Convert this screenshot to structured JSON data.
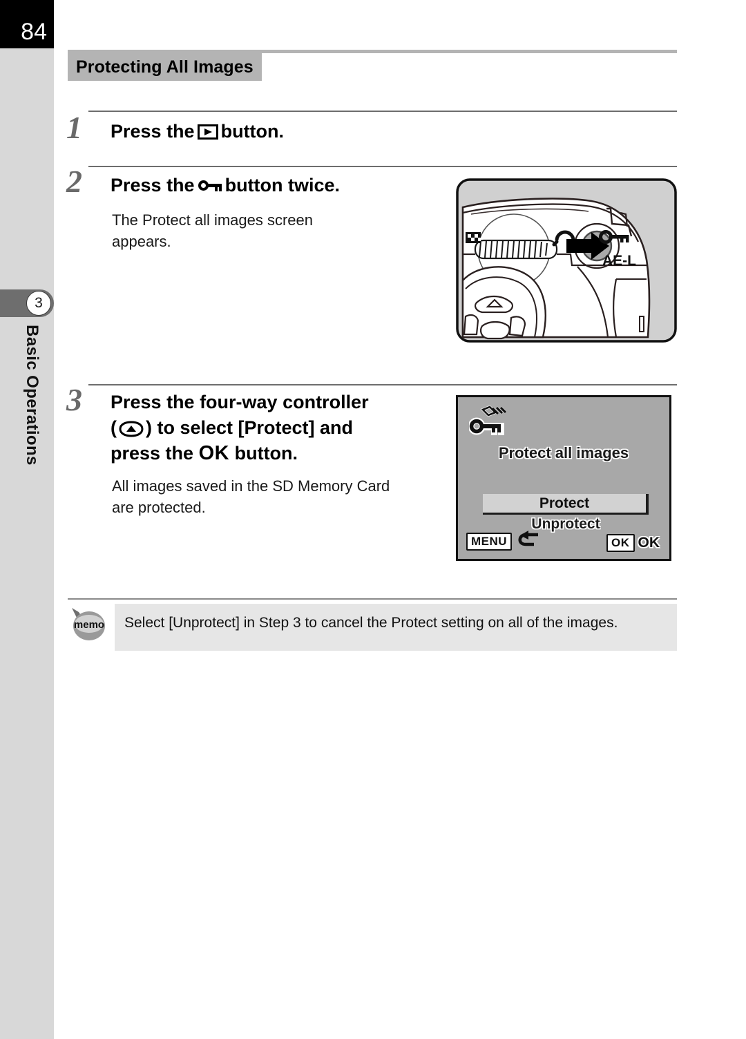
{
  "page": {
    "number": "84",
    "chapter_number": "3",
    "chapter_label": "Basic Operations"
  },
  "section": {
    "title": "Protecting All Images"
  },
  "steps": [
    {
      "number": "1",
      "heading_before": "Press the",
      "icon": "playback-button-icon",
      "heading_after": "button.",
      "body": ""
    },
    {
      "number": "2",
      "heading_before": "Press the",
      "icon": "protect-key-icon",
      "heading_after": "button twice.",
      "body": "The Protect all images screen appears."
    },
    {
      "number": "3",
      "heading_line1": "Press the four-way controller",
      "icon": "four-way-controller-up-icon",
      "heading_line2_before": "(",
      "heading_line2_after": ") to select [Protect] and",
      "heading_line3_before": "press the",
      "heading_ok": "OK",
      "heading_line3_after": "button.",
      "body": "All images saved in the SD Memory Card are protected."
    }
  ],
  "camera_figure": {
    "ae_l_label": "AE-L",
    "icons": [
      "checkerboard-index-icon",
      "magnify-icon",
      "protect-key-icon"
    ]
  },
  "lcd_figure": {
    "icon": "protect-all-images-icon",
    "title": "Protect all images",
    "options": [
      "Protect",
      "Unprotect"
    ],
    "selected_option": "Protect",
    "footer_left_key": "MENU",
    "footer_left_icon": "back-arrow-icon",
    "footer_right_key": "OK",
    "footer_right_label": "OK"
  },
  "memo": {
    "icon_label": "memo",
    "text": "Select [Unprotect] in Step 3 to cancel the Protect setting on all of the images."
  },
  "colors": {
    "page_number_bg": "#000000",
    "rail_bg": "#d8d8d8",
    "chapter_tab_bg": "#6e6e6e",
    "section_title_bg": "#b4b4b4",
    "memo_bg": "#e6e6e6",
    "lcd_bg": "#a8a8a8",
    "camera_bg": "#d0d0d0"
  }
}
